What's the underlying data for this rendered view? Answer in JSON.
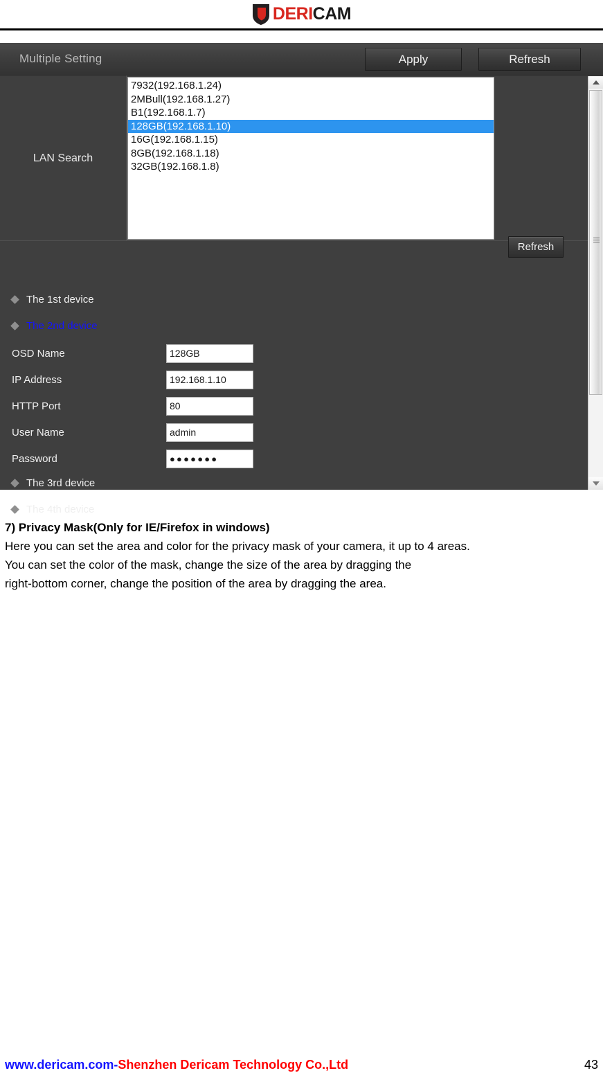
{
  "header": {
    "logo_icon": "shield-icon",
    "logo_primary": "DERI",
    "logo_secondary": "CAM",
    "brand_red": "#d8271f",
    "brand_dark": "#1a1a1a"
  },
  "panel": {
    "title": "Multiple Setting",
    "apply_label": "Apply",
    "refresh_label": "Refresh",
    "lan_search": {
      "label": "LAN Search",
      "refresh_label": "Refresh",
      "selected_index": 3,
      "items": [
        "7932(192.168.1.24)",
        "2MBull(192.168.1.27)",
        "B1(192.168.1.7)",
        "128GB(192.168.1.10)",
        "16G(192.168.1.15)",
        "8GB(192.168.1.18)",
        "32GB(192.168.1.8)"
      ]
    },
    "devices": [
      {
        "label": "The 1st device",
        "active": false
      },
      {
        "label": "The 2nd device",
        "active": true
      },
      {
        "label": "The 3rd device",
        "active": false
      },
      {
        "label": "The 4th device",
        "active": false
      }
    ],
    "fields": [
      {
        "label": "OSD Name",
        "value": "128GB"
      },
      {
        "label": "IP Address",
        "value": "192.168.1.10"
      },
      {
        "label": "HTTP Port",
        "value": "80"
      },
      {
        "label": "User Name",
        "value": "admin"
      },
      {
        "label": "Password",
        "value": "●●●●●●●"
      }
    ],
    "accent_selected": "#2d94ef",
    "panel_bg": "#3f3f3f"
  },
  "scrollbar": {
    "up_icon": "triangle-up-icon",
    "down_icon": "triangle-down-icon",
    "grip_icon": "grip-lines-icon"
  },
  "content": {
    "heading": "7) Privacy Mask(Only for IE/Firefox in windows)",
    "lines": [
      "Here you can set the area and color for the privacy mask of your camera, it up to 4 areas.",
      "You can set the color of the mask, change the size of the area by dragging the",
      "right-bottom corner, change the position of the area by dragging the area."
    ]
  },
  "footer": {
    "url": "www.dericam.com-",
    "company": "Shenzhen Dericam Technology Co.,Ltd",
    "page_number": "43"
  }
}
